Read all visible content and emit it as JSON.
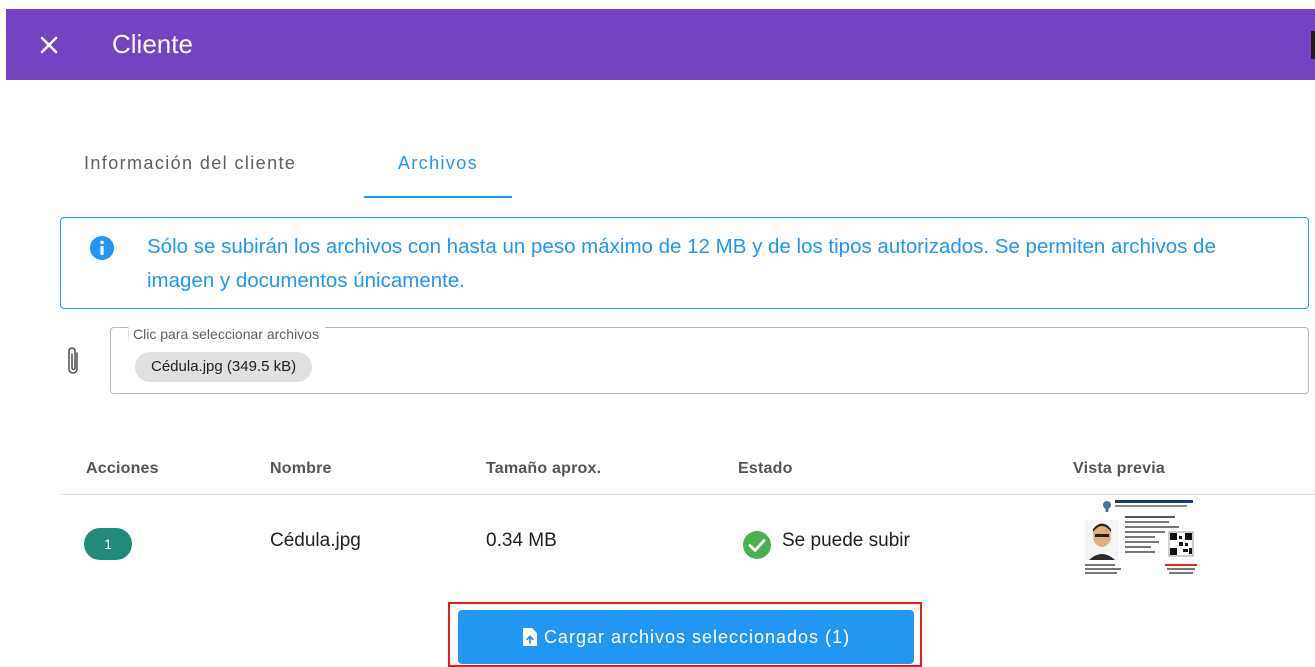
{
  "header": {
    "title": "Cliente",
    "close_icon": "close-icon"
  },
  "tabs": [
    {
      "label": "Información del cliente",
      "active": false
    },
    {
      "label": "Archivos",
      "active": true
    }
  ],
  "alert": {
    "icon": "info-icon",
    "message": "Sólo se subirán los archivos con hasta un peso máximo de 12 MB y de los tipos autorizados. Se permiten archivos de imagen y documentos únicamente."
  },
  "file_input": {
    "icon": "paperclip-icon",
    "label": "Clic para seleccionar archivos",
    "chip": "Cédula.jpg (349.5 kB)"
  },
  "table": {
    "headers": [
      "Acciones",
      "Nombre",
      "Tamaño aprox.",
      "Estado",
      "Vista previa"
    ],
    "rows": [
      {
        "accion": "1",
        "nombre": "Cédula.jpg",
        "tamano": "0.34 MB",
        "estado": "Se puede subir",
        "estado_icon": "check-circle-icon",
        "preview": "id-card-thumbnail"
      }
    ]
  },
  "upload_button": {
    "label": "Cargar archivos seleccionados (1)",
    "icon": "file-upload-icon"
  },
  "colors": {
    "appbar": "#7243c2",
    "primary": "#2196f3",
    "badge": "#1e8a78",
    "success": "#4caf50",
    "highlight": "#e31b1b"
  }
}
